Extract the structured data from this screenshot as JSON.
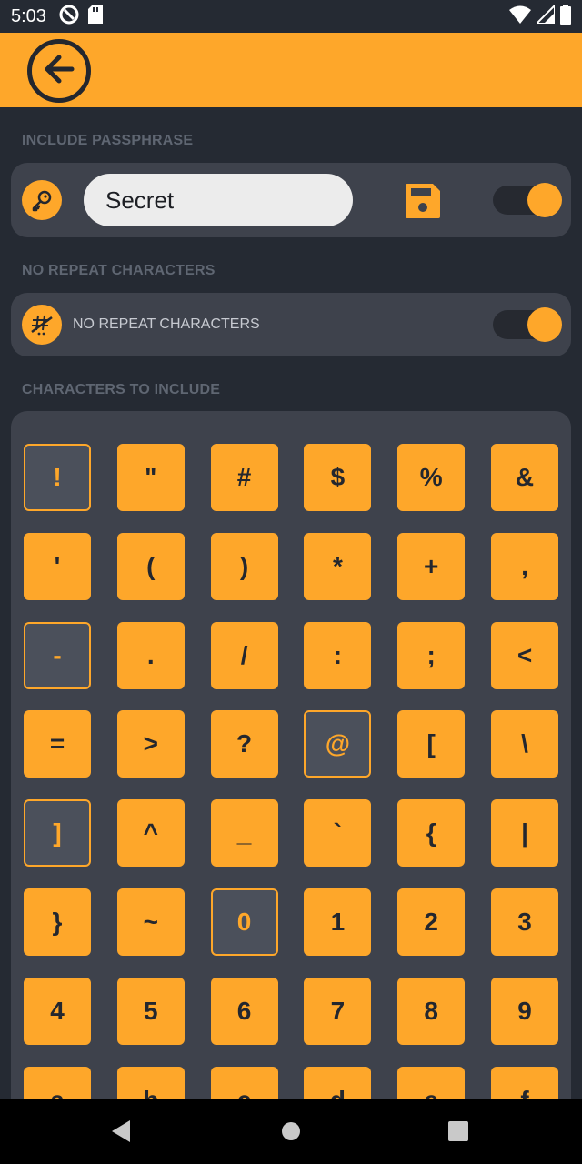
{
  "status_bar": {
    "time": "5:03",
    "left_icons": [
      "at-sign-icon",
      "sd-card-icon"
    ],
    "right_icons": [
      "wifi-icon",
      "signal-icon",
      "battery-icon"
    ]
  },
  "app_bar": {
    "back_icon": "back-arrow-icon"
  },
  "passphrase_section": {
    "label": "INCLUDE PASSPHRASE",
    "input_value": "Secret",
    "icon": "key-icon",
    "save_icon": "save-icon",
    "toggle_on": true
  },
  "no_repeat_section": {
    "label": "NO REPEAT CHARACTERS",
    "row_text": "NO REPEAT CHARACTERS",
    "icon": "no-repeat-icon",
    "toggle_on": true
  },
  "characters_section": {
    "label": "CHARACTERS TO INCLUDE",
    "keys": [
      {
        "char": "!",
        "selected": false
      },
      {
        "char": "\"",
        "selected": true
      },
      {
        "char": "#",
        "selected": true
      },
      {
        "char": "$",
        "selected": true
      },
      {
        "char": "%",
        "selected": true
      },
      {
        "char": "&",
        "selected": true
      },
      {
        "char": "'",
        "selected": true
      },
      {
        "char": "(",
        "selected": true
      },
      {
        "char": ")",
        "selected": true
      },
      {
        "char": "*",
        "selected": true
      },
      {
        "char": "+",
        "selected": true
      },
      {
        "char": ",",
        "selected": true
      },
      {
        "char": "-",
        "selected": false
      },
      {
        "char": ".",
        "selected": true
      },
      {
        "char": "/",
        "selected": true
      },
      {
        "char": ":",
        "selected": true
      },
      {
        "char": ";",
        "selected": true
      },
      {
        "char": "<",
        "selected": true
      },
      {
        "char": "=",
        "selected": true
      },
      {
        "char": ">",
        "selected": true
      },
      {
        "char": "?",
        "selected": true
      },
      {
        "char": "@",
        "selected": false
      },
      {
        "char": "[",
        "selected": true
      },
      {
        "char": "\\",
        "selected": true
      },
      {
        "char": "]",
        "selected": false
      },
      {
        "char": "^",
        "selected": true
      },
      {
        "char": "_",
        "selected": true
      },
      {
        "char": "`",
        "selected": true
      },
      {
        "char": "{",
        "selected": true
      },
      {
        "char": "|",
        "selected": true
      },
      {
        "char": "}",
        "selected": true
      },
      {
        "char": "~",
        "selected": true
      },
      {
        "char": "0",
        "selected": false
      },
      {
        "char": "1",
        "selected": true
      },
      {
        "char": "2",
        "selected": true
      },
      {
        "char": "3",
        "selected": true
      },
      {
        "char": "4",
        "selected": true
      },
      {
        "char": "5",
        "selected": true
      },
      {
        "char": "6",
        "selected": true
      },
      {
        "char": "7",
        "selected": true
      },
      {
        "char": "8",
        "selected": true
      },
      {
        "char": "9",
        "selected": true
      },
      {
        "char": "a",
        "selected": true
      },
      {
        "char": "b",
        "selected": true
      },
      {
        "char": "c",
        "selected": true
      },
      {
        "char": "d",
        "selected": true
      },
      {
        "char": "e",
        "selected": true
      },
      {
        "char": "f",
        "selected": true
      }
    ]
  },
  "nav_bar": {
    "icons": [
      "back-triangle-icon",
      "home-circle-icon",
      "recents-square-icon"
    ]
  },
  "colors": {
    "accent": "#fea72a",
    "background": "#252a33",
    "card": "#3e424c"
  }
}
